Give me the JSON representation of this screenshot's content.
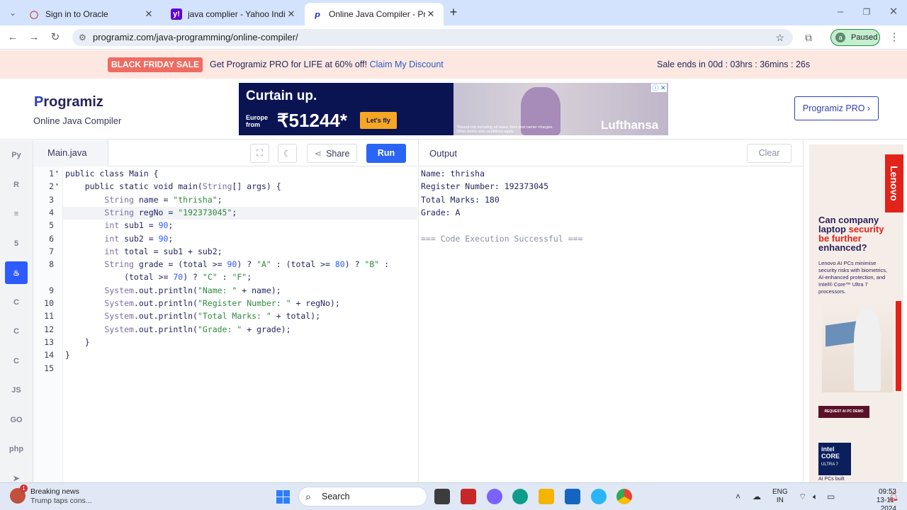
{
  "browser": {
    "tabs": [
      {
        "title": "Sign in to Oracle",
        "icon": "oracle-icon",
        "color": "#c74634"
      },
      {
        "title": "java complier - Yahoo India Sea",
        "icon": "yahoo-icon",
        "color": "#6001d2"
      },
      {
        "title": "Online Java Compiler - Program",
        "icon": "programiz-icon",
        "color": "#2e3fb5"
      }
    ],
    "url": "programiz.com/java-programming/online-compiler/",
    "profile_initial": "a",
    "profile_status": "Paused"
  },
  "promo": {
    "badge": "BLACK FRIDAY SALE",
    "text": "Get Programiz PRO for LIFE at 60% off! ",
    "link": "Claim My Discount",
    "ends": "Sale ends in 00d : 03hrs : 36mins : 26s"
  },
  "header": {
    "logo_p": "P",
    "logo_rest": "rogramiz",
    "subtitle": "Online Java Compiler",
    "pro_button": "Programiz PRO ›"
  },
  "ad_top": {
    "headline": "Curtain up.",
    "from_label_1": "Europe",
    "from_label_2": "from",
    "price": "₹51244*",
    "cta": "Let's fly",
    "brand": "Lufthansa",
    "fine_1": "*Round-trip including all taxes, fees and carrier charges.",
    "fine_2": "Other terms and conditions apply."
  },
  "sidebar": {
    "languages": [
      {
        "name": "python-icon",
        "glyph": "Py"
      },
      {
        "name": "r-icon",
        "glyph": "R"
      },
      {
        "name": "sql-icon",
        "glyph": "≡"
      },
      {
        "name": "html-icon",
        "glyph": "5"
      },
      {
        "name": "java-icon",
        "glyph": "♨"
      },
      {
        "name": "c-icon",
        "glyph": "C"
      },
      {
        "name": "cpp-icon",
        "glyph": "C"
      },
      {
        "name": "csharp-icon",
        "glyph": "C"
      },
      {
        "name": "js-icon",
        "glyph": "JS"
      },
      {
        "name": "go-icon",
        "glyph": "GO"
      },
      {
        "name": "php-icon",
        "glyph": "php"
      },
      {
        "name": "swift-icon",
        "glyph": "➤"
      }
    ]
  },
  "editor": {
    "file": "Main.java",
    "share": "Share",
    "run": "Run",
    "lines": [
      {
        "n": "1",
        "fold": "▾",
        "text": "public class Main {"
      },
      {
        "n": "2",
        "fold": "▾",
        "text": "    public static void main(String[] args) {"
      },
      {
        "n": "3",
        "fold": "",
        "text": "        String name = \"thrisha\";"
      },
      {
        "n": "4",
        "fold": "",
        "text": "        String regNo = \"192373045\";"
      },
      {
        "n": "5",
        "fold": "",
        "text": "        int sub1 = 90;"
      },
      {
        "n": "6",
        "fold": "",
        "text": "        int sub2 = 90;"
      },
      {
        "n": "7",
        "fold": "",
        "text": "        int total = sub1 + sub2;"
      },
      {
        "n": "8",
        "fold": "",
        "text": "        String grade = (total >= 90) ? \"A\" : (total >= 80) ? \"B\" :"
      },
      {
        "n": "",
        "fold": "",
        "text": "            (total >= 70) ? \"C\" : \"F\";"
      },
      {
        "n": "9",
        "fold": "",
        "text": "        System.out.println(\"Name: \" + name);"
      },
      {
        "n": "10",
        "fold": "",
        "text": "        System.out.println(\"Register Number: \" + regNo);"
      },
      {
        "n": "11",
        "fold": "",
        "text": "        System.out.println(\"Total Marks: \" + total);"
      },
      {
        "n": "12",
        "fold": "",
        "text": "        System.out.println(\"Grade: \" + grade);"
      },
      {
        "n": "13",
        "fold": "",
        "text": "    }"
      },
      {
        "n": "14",
        "fold": "",
        "text": "}"
      },
      {
        "n": "15",
        "fold": "",
        "text": ""
      }
    ]
  },
  "output": {
    "title": "Output",
    "clear": "Clear",
    "lines": [
      "Name: thrisha",
      "Register Number: 192373045",
      "Total Marks: 180",
      "Grade: A",
      "",
      "=== Code Execution Successful ==="
    ]
  },
  "ad_right": {
    "brand": "Lenovo",
    "headline_1": "Can company laptop ",
    "headline_red": "security be further",
    "headline_2": "enhanced?",
    "body": "Lenovo AI PCs minimise security risks with biometrics, AI-enhanced protection, and Intel® Core™ Ultra 7 processors.",
    "cta": "REQUEST AI PC DEMO",
    "intel_1": "intel",
    "intel_2": "CORE",
    "intel_3": "ULTRA 7",
    "footer": "AI PCs built"
  },
  "taskbar": {
    "news_title": "Breaking news",
    "news_sub": "Trump taps cons...",
    "news_badge": "1",
    "search": "Search",
    "lang_1": "ENG",
    "lang_2": "IN",
    "time": "09:53",
    "date": "13-11-2024"
  }
}
